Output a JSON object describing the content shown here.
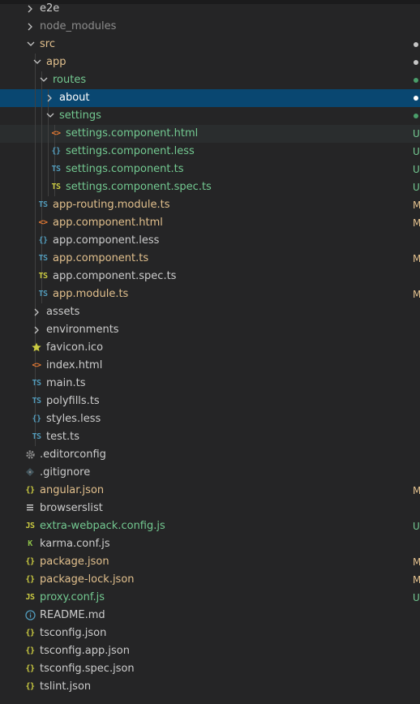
{
  "colors": {
    "folder": "#cccccc",
    "file": "#cccccc",
    "modified": "#e2c08d",
    "untracked": "#73c991",
    "ignored": "#8c8c8c",
    "selected_text": "#ffffff",
    "dot": "#c5c5c5",
    "dot_untracked": "#4a9e6a"
  },
  "tree": [
    {
      "name": "e2e",
      "type": "folder",
      "depth": 0,
      "expanded": false,
      "status": "",
      "dot": false
    },
    {
      "name": "node_modules",
      "type": "folder",
      "depth": 0,
      "expanded": false,
      "status": "ignored",
      "dot": false
    },
    {
      "name": "src",
      "type": "folder",
      "depth": 0,
      "expanded": true,
      "status": "modified",
      "dot": true
    },
    {
      "name": "app",
      "type": "folder",
      "depth": 1,
      "expanded": true,
      "status": "modified",
      "dot": true
    },
    {
      "name": "routes",
      "type": "folder",
      "depth": 2,
      "expanded": true,
      "status": "untracked",
      "dot": true
    },
    {
      "name": "about",
      "type": "folder",
      "depth": 3,
      "expanded": false,
      "status": "selected",
      "dot": true,
      "selected": true
    },
    {
      "name": "settings",
      "type": "folder",
      "depth": 3,
      "expanded": true,
      "status": "untracked",
      "dot": true
    },
    {
      "name": "settings.component.html",
      "type": "html",
      "depth": 4,
      "status": "untracked",
      "badge": "U",
      "hover": true
    },
    {
      "name": "settings.component.less",
      "type": "less",
      "depth": 4,
      "status": "untracked",
      "badge": "U"
    },
    {
      "name": "settings.component.ts",
      "type": "ts",
      "depth": 4,
      "status": "untracked",
      "badge": "U"
    },
    {
      "name": "settings.component.spec.ts",
      "type": "spec",
      "depth": 4,
      "status": "untracked",
      "badge": "U"
    },
    {
      "name": "app-routing.module.ts",
      "type": "ts",
      "depth": 2,
      "status": "modified",
      "badge": "M"
    },
    {
      "name": "app.component.html",
      "type": "html",
      "depth": 2,
      "status": "modified",
      "badge": "M"
    },
    {
      "name": "app.component.less",
      "type": "less",
      "depth": 2,
      "status": "",
      "badge": ""
    },
    {
      "name": "app.component.ts",
      "type": "ts",
      "depth": 2,
      "status": "modified",
      "badge": "M"
    },
    {
      "name": "app.component.spec.ts",
      "type": "spec",
      "depth": 2,
      "status": "",
      "badge": ""
    },
    {
      "name": "app.module.ts",
      "type": "ts",
      "depth": 2,
      "status": "modified",
      "badge": "M"
    },
    {
      "name": "assets",
      "type": "folder",
      "depth": 1,
      "expanded": false,
      "status": "",
      "dot": false
    },
    {
      "name": "environments",
      "type": "folder",
      "depth": 1,
      "expanded": false,
      "status": "",
      "dot": false
    },
    {
      "name": "favicon.ico",
      "type": "star",
      "depth": 1,
      "status": "",
      "badge": ""
    },
    {
      "name": "index.html",
      "type": "html",
      "depth": 1,
      "status": "",
      "badge": ""
    },
    {
      "name": "main.ts",
      "type": "ts",
      "depth": 1,
      "status": "",
      "badge": ""
    },
    {
      "name": "polyfills.ts",
      "type": "ts",
      "depth": 1,
      "status": "",
      "badge": ""
    },
    {
      "name": "styles.less",
      "type": "less",
      "depth": 1,
      "status": "",
      "badge": ""
    },
    {
      "name": "test.ts",
      "type": "ts",
      "depth": 1,
      "status": "",
      "badge": ""
    },
    {
      "name": ".editorconfig",
      "type": "gear",
      "depth": 0,
      "status": "",
      "badge": ""
    },
    {
      "name": ".gitignore",
      "type": "diamond",
      "depth": 0,
      "status": "",
      "badge": ""
    },
    {
      "name": "angular.json",
      "type": "json",
      "depth": 0,
      "status": "modified",
      "badge": "M"
    },
    {
      "name": "browserslist",
      "type": "lines",
      "depth": 0,
      "status": "",
      "badge": ""
    },
    {
      "name": "extra-webpack.config.js",
      "type": "js",
      "depth": 0,
      "status": "untracked",
      "badge": "U"
    },
    {
      "name": "karma.conf.js",
      "type": "karma",
      "depth": 0,
      "status": "",
      "badge": ""
    },
    {
      "name": "package.json",
      "type": "json",
      "depth": 0,
      "status": "modified",
      "badge": "M"
    },
    {
      "name": "package-lock.json",
      "type": "json",
      "depth": 0,
      "status": "modified",
      "badge": "M"
    },
    {
      "name": "proxy.conf.js",
      "type": "js",
      "depth": 0,
      "status": "untracked",
      "badge": "U"
    },
    {
      "name": "README.md",
      "type": "info",
      "depth": 0,
      "status": "",
      "badge": ""
    },
    {
      "name": "tsconfig.json",
      "type": "json",
      "depth": 0,
      "status": "",
      "badge": ""
    },
    {
      "name": "tsconfig.app.json",
      "type": "json",
      "depth": 0,
      "status": "",
      "badge": ""
    },
    {
      "name": "tsconfig.spec.json",
      "type": "json",
      "depth": 0,
      "status": "",
      "badge": ""
    },
    {
      "name": "tslint.json",
      "type": "json",
      "depth": 0,
      "status": "",
      "badge": ""
    }
  ]
}
